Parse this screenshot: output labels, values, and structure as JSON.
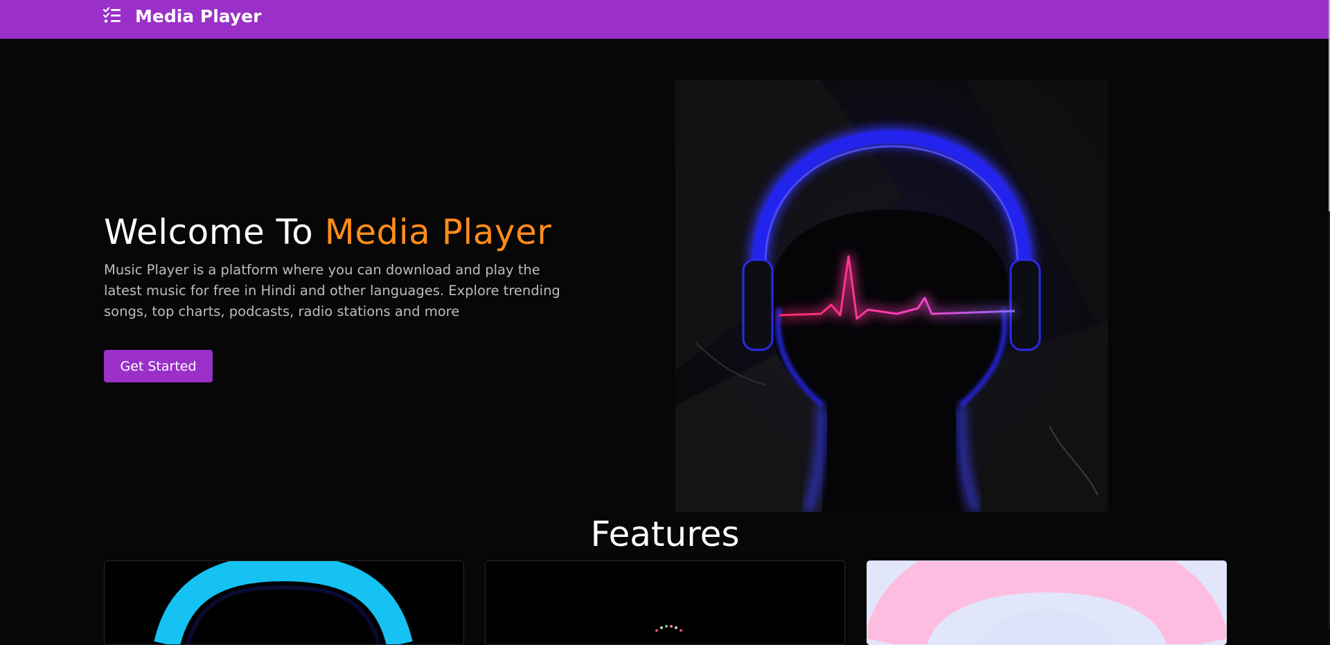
{
  "navbar": {
    "brand": "Media Player",
    "menu_icon": "checklist-menu-icon",
    "background": "#9a30c8"
  },
  "hero": {
    "title_prefix": "Welcome To ",
    "title_highlight": "Media Player",
    "highlight_color": "#ff8c1a",
    "description": "Music Player is a platform where you can download and play the latest music for free in Hindi and other languages. Explore trending songs, top charts, podcasts, radio stations and more",
    "cta_label": "Get Started",
    "image_icon": "neon-headphones-heartbeat-illustration"
  },
  "features": {
    "heading": "Features",
    "cards": [
      {
        "icon": "cyan-ring-image"
      },
      {
        "icon": "dotted-equalizer-image"
      },
      {
        "icon": "pink-ring-image"
      }
    ]
  }
}
